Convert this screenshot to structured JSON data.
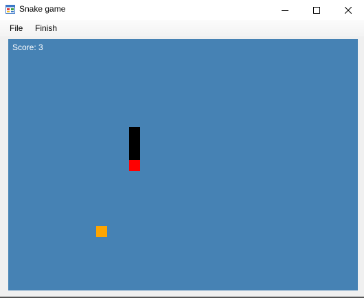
{
  "window": {
    "title": "Snake game",
    "icon": "windows-form-icon"
  },
  "menu": {
    "items": [
      {
        "label": "File"
      },
      {
        "label": "Finish"
      }
    ]
  },
  "game": {
    "score_text": "Score: 3",
    "board_color": "#4682b4",
    "grid_cell": "board cell units",
    "snake": {
      "head_color": "#ff0000",
      "body_color": "#000000",
      "segments": [
        {
          "col": 11,
          "row": 11,
          "part": "head"
        },
        {
          "col": 11,
          "row": 10,
          "part": "body"
        },
        {
          "col": 11,
          "row": 9,
          "part": "body"
        },
        {
          "col": 11,
          "row": 8,
          "part": "body"
        }
      ]
    },
    "food": {
      "color": "#ffa500",
      "col": 8,
      "row": 17
    }
  }
}
